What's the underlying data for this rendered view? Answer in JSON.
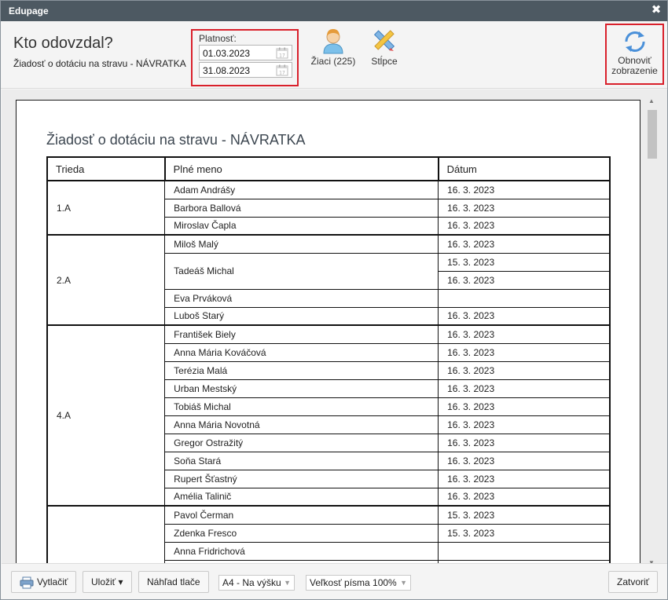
{
  "window": {
    "title": "Edupage",
    "close_glyph": "✖"
  },
  "header": {
    "title": "Kto odovzdal?",
    "subtitle": "Žiadosť o dotáciu na stravu - NÁVRATKA",
    "validity_label": "Platnosť:",
    "date_from": "01.03.2023",
    "date_to": "31.08.2023",
    "students_label": "Žiaci (225)",
    "columns_label": "Stĺpce",
    "refresh_label_1": "Obnoviť",
    "refresh_label_2": "zobrazenie"
  },
  "icons": {
    "close": "close-icon",
    "calendar": "calendar-icon",
    "students": "student-icon",
    "columns": "pencil-ruler-icon",
    "refresh": "refresh-icon",
    "print": "printer-icon"
  },
  "report": {
    "title": "Žiadosť o dotáciu na stravu - NÁVRATKA",
    "headers": [
      "Trieda",
      "Plné meno",
      "Dátum"
    ],
    "groups": [
      {
        "class": "1.A",
        "students": [
          {
            "name": "Adam Andrášy",
            "dates": [
              "16. 3. 2023"
            ]
          },
          {
            "name": "Barbora Ballová",
            "dates": [
              "16. 3. 2023"
            ]
          },
          {
            "name": "Miroslav Čapla",
            "dates": [
              "16. 3. 2023"
            ]
          }
        ]
      },
      {
        "class": "2.A",
        "students": [
          {
            "name": "Miloš Malý",
            "dates": [
              "16. 3. 2023"
            ]
          },
          {
            "name": "Tadeáš Michal",
            "dates": [
              "15. 3. 2023",
              "16. 3. 2023"
            ]
          },
          {
            "name": "Eva Prváková",
            "dates": [
              ""
            ]
          },
          {
            "name": "Luboš Starý",
            "dates": [
              "16. 3. 2023"
            ]
          }
        ]
      },
      {
        "class": "4.A",
        "students": [
          {
            "name": "František Biely",
            "dates": [
              "16. 3. 2023"
            ]
          },
          {
            "name": "Anna Mária Kováčová",
            "dates": [
              "16. 3. 2023"
            ]
          },
          {
            "name": "Terézia Malá",
            "dates": [
              "16. 3. 2023"
            ]
          },
          {
            "name": "Urban Mestský",
            "dates": [
              "16. 3. 2023"
            ]
          },
          {
            "name": "Tobiáš Michal",
            "dates": [
              "16. 3. 2023"
            ]
          },
          {
            "name": "Anna Mária Novotná",
            "dates": [
              "16. 3. 2023"
            ]
          },
          {
            "name": "Gregor Ostražitý",
            "dates": [
              "16. 3. 2023"
            ]
          },
          {
            "name": "Soňa Stará",
            "dates": [
              "16. 3. 2023"
            ]
          },
          {
            "name": "Rupert Šťastný",
            "dates": [
              "16. 3. 2023"
            ]
          },
          {
            "name": "Amélia Talinič",
            "dates": [
              "16. 3. 2023"
            ]
          }
        ]
      },
      {
        "class": "",
        "students": [
          {
            "name": "Pavol Čerman",
            "dates": [
              "15. 3. 2023"
            ]
          },
          {
            "name": "Zdenka Fresco",
            "dates": [
              "15. 3. 2023"
            ]
          },
          {
            "name": "Anna Fridrichová",
            "dates": [
              ""
            ]
          },
          {
            "name": "",
            "dates": [
              ""
            ]
          }
        ]
      }
    ]
  },
  "footer": {
    "print_label": "Vytlačiť",
    "save_label": "Uložiť ▾",
    "preview_label": "Náhľad tlače",
    "paper_value": "A4 - Na výšku",
    "font_value": "Veľkosť písma 100%",
    "close_label": "Zatvoriť"
  },
  "colors": {
    "titlebar": "#4d5962",
    "highlight_border": "#d9202b",
    "refresh_icon": "#4a90d9"
  }
}
